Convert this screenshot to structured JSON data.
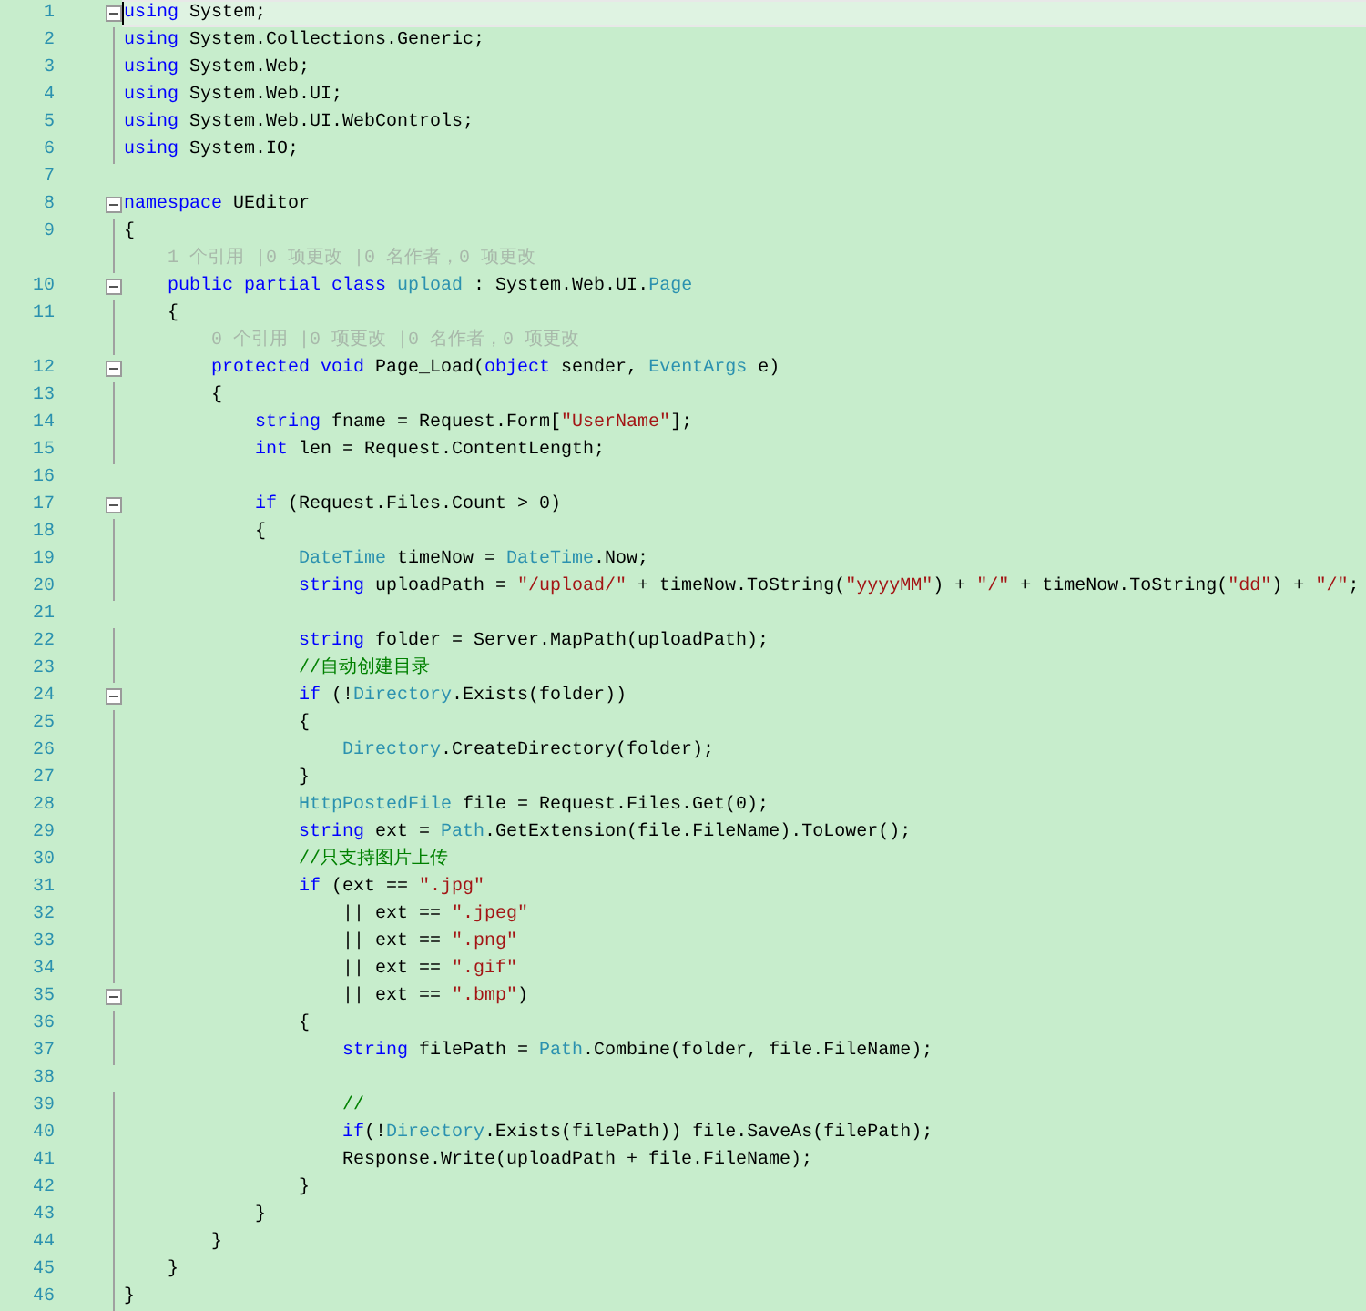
{
  "lines": [
    {
      "kind": "code",
      "n": "1",
      "fold": true,
      "current": true,
      "tokens": [
        {
          "kind": "kw",
          "text": "using"
        },
        {
          "kind": "plain",
          "text": " System;"
        }
      ]
    },
    {
      "kind": "code",
      "n": "2",
      "fold": false,
      "current": false,
      "tokens": [
        {
          "kind": "kw",
          "text": "using"
        },
        {
          "kind": "plain",
          "text": " System.Collections.Generic;"
        }
      ]
    },
    {
      "kind": "code",
      "n": "3",
      "fold": false,
      "current": false,
      "tokens": [
        {
          "kind": "kw",
          "text": "using"
        },
        {
          "kind": "plain",
          "text": " System.Web;"
        }
      ]
    },
    {
      "kind": "code",
      "n": "4",
      "fold": false,
      "current": false,
      "tokens": [
        {
          "kind": "kw",
          "text": "using"
        },
        {
          "kind": "plain",
          "text": " System.Web.UI;"
        }
      ]
    },
    {
      "kind": "code",
      "n": "5",
      "fold": false,
      "current": false,
      "tokens": [
        {
          "kind": "kw",
          "text": "using"
        },
        {
          "kind": "plain",
          "text": " System.Web.UI.WebControls;"
        }
      ]
    },
    {
      "kind": "code",
      "n": "6",
      "fold": false,
      "current": false,
      "tokens": [
        {
          "kind": "kw",
          "text": "using"
        },
        {
          "kind": "plain",
          "text": " System.IO;"
        }
      ]
    },
    {
      "kind": "code",
      "n": "7",
      "fold": false,
      "current": false
    },
    {
      "kind": "code",
      "n": "8",
      "fold": true,
      "current": false,
      "tokens": [
        {
          "kind": "kw",
          "text": "namespace"
        },
        {
          "kind": "plain",
          "text": " UEditor"
        }
      ]
    },
    {
      "kind": "code",
      "n": "9",
      "fold": false,
      "current": false,
      "tokens": [
        {
          "kind": "plain",
          "text": "{"
        }
      ],
      "children": [
        {
          "kind": "lens",
          "text": "1 个引用 |0 项更改 |0 名作者，0 项更改"
        },
        {
          "kind": "code",
          "n": "10",
          "fold": true,
          "current": false,
          "tokens": [
            {
              "kind": "kw",
              "text": "public partial class"
            },
            {
              "kind": "type",
              "text": " upload"
            },
            {
              "kind": "plain",
              "text": " : System.Web.UI."
            },
            {
              "kind": "type",
              "text": "Page"
            }
          ]
        },
        {
          "kind": "code",
          "n": "11",
          "fold": false,
          "current": false,
          "tokens": [
            {
              "kind": "plain",
              "text": "{"
            }
          ],
          "children": [
            {
              "kind": "lens",
              "text": "0 个引用 |0 项更改 |0 名作者，0 项更改"
            },
            {
              "kind": "code",
              "n": "12",
              "fold": true,
              "current": false,
              "tokens": [
                {
                  "kind": "kw",
                  "text": "protected void"
                },
                {
                  "kind": "plain",
                  "text": " Page_Load("
                },
                {
                  "kind": "kw",
                  "text": "object"
                },
                {
                  "kind": "plain",
                  "text": " sender, "
                },
                {
                  "kind": "type",
                  "text": "EventArgs"
                },
                {
                  "kind": "plain",
                  "text": " e)"
                }
              ]
            },
            {
              "kind": "code",
              "n": "13",
              "fold": false,
              "current": false,
              "tokens": [
                {
                  "kind": "plain",
                  "text": "{"
                }
              ],
              "children": [
                {
                  "kind": "code",
                  "n": "14",
                  "fold": false,
                  "current": false,
                  "tokens": [
                    {
                      "kind": "kw",
                      "text": "string"
                    },
                    {
                      "kind": "plain",
                      "text": " fname = Request.Form["
                    },
                    {
                      "kind": "str",
                      "text": "\"UserName\""
                    },
                    {
                      "kind": "plain",
                      "text": "];"
                    }
                  ]
                },
                {
                  "kind": "code",
                  "n": "15",
                  "fold": false,
                  "current": false,
                  "tokens": [
                    {
                      "kind": "kw",
                      "text": "int"
                    },
                    {
                      "kind": "plain",
                      "text": " len = Request.ContentLength;"
                    }
                  ]
                },
                {
                  "kind": "code",
                  "n": "16",
                  "fold": false,
                  "current": false
                },
                {
                  "kind": "code",
                  "n": "17",
                  "fold": true,
                  "current": false,
                  "tokens": [
                    {
                      "kind": "kw",
                      "text": "if"
                    },
                    {
                      "kind": "plain",
                      "text": " (Request.Files.Count > 0)"
                    }
                  ]
                },
                {
                  "kind": "code",
                  "n": "18",
                  "fold": false,
                  "current": false,
                  "tokens": [
                    {
                      "kind": "plain",
                      "text": "{"
                    }
                  ],
                  "children": [
                    {
                      "kind": "code",
                      "n": "19",
                      "fold": false,
                      "current": false,
                      "tokens": [
                        {
                          "kind": "type",
                          "text": "DateTime"
                        },
                        {
                          "kind": "plain",
                          "text": " timeNow = "
                        },
                        {
                          "kind": "type",
                          "text": "DateTime"
                        },
                        {
                          "kind": "plain",
                          "text": ".Now;"
                        }
                      ]
                    },
                    {
                      "kind": "code",
                      "n": "20",
                      "fold": false,
                      "current": false,
                      "tokens": [
                        {
                          "kind": "kw",
                          "text": "string"
                        },
                        {
                          "kind": "plain",
                          "text": " uploadPath = "
                        },
                        {
                          "kind": "str",
                          "text": "\"/upload/\""
                        },
                        {
                          "kind": "plain",
                          "text": " + timeNow.ToString("
                        },
                        {
                          "kind": "str",
                          "text": "\"yyyyMM\""
                        },
                        {
                          "kind": "plain",
                          "text": ") + "
                        },
                        {
                          "kind": "str",
                          "text": "\"/\""
                        },
                        {
                          "kind": "plain",
                          "text": " + timeNow.ToString("
                        },
                        {
                          "kind": "str",
                          "text": "\"dd\""
                        },
                        {
                          "kind": "plain",
                          "text": ") + "
                        },
                        {
                          "kind": "str",
                          "text": "\"/\""
                        },
                        {
                          "kind": "plain",
                          "text": ";"
                        }
                      ]
                    },
                    {
                      "kind": "code",
                      "n": "21",
                      "fold": false,
                      "current": false
                    },
                    {
                      "kind": "code",
                      "n": "22",
                      "fold": false,
                      "current": false,
                      "tokens": [
                        {
                          "kind": "kw",
                          "text": "string"
                        },
                        {
                          "kind": "plain",
                          "text": " folder = Server.MapPath(uploadPath);"
                        }
                      ]
                    },
                    {
                      "kind": "code",
                      "n": "23",
                      "fold": false,
                      "current": false,
                      "tokens": [
                        {
                          "kind": "comment",
                          "text": "//自动创建目录"
                        }
                      ]
                    },
                    {
                      "kind": "code",
                      "n": "24",
                      "fold": true,
                      "current": false,
                      "tokens": [
                        {
                          "kind": "kw",
                          "text": "if"
                        },
                        {
                          "kind": "plain",
                          "text": " (!"
                        },
                        {
                          "kind": "type",
                          "text": "Directory"
                        },
                        {
                          "kind": "plain",
                          "text": ".Exists(folder))"
                        }
                      ]
                    },
                    {
                      "kind": "code",
                      "n": "25",
                      "fold": false,
                      "current": false,
                      "tokens": [
                        {
                          "kind": "plain",
                          "text": "{"
                        }
                      ],
                      "children": [
                        {
                          "kind": "code",
                          "n": "26",
                          "fold": false,
                          "current": false,
                          "tokens": [
                            {
                              "kind": "type",
                              "text": "Directory"
                            },
                            {
                              "kind": "plain",
                              "text": ".CreateDirectory(folder);"
                            }
                          ]
                        }
                      ]
                    },
                    {
                      "kind": "code",
                      "n": "27",
                      "fold": false,
                      "current": false,
                      "tokens": [
                        {
                          "kind": "plain",
                          "text": "}"
                        }
                      ]
                    },
                    {
                      "kind": "code",
                      "n": "28",
                      "fold": false,
                      "current": false,
                      "tokens": [
                        {
                          "kind": "type",
                          "text": "HttpPostedFile"
                        },
                        {
                          "kind": "plain",
                          "text": " file = Request.Files.Get(0);"
                        }
                      ]
                    },
                    {
                      "kind": "code",
                      "n": "29",
                      "fold": false,
                      "current": false,
                      "tokens": [
                        {
                          "kind": "kw",
                          "text": "string"
                        },
                        {
                          "kind": "plain",
                          "text": " ext = "
                        },
                        {
                          "kind": "type",
                          "text": "Path"
                        },
                        {
                          "kind": "plain",
                          "text": ".GetExtension(file.FileName).ToLower();"
                        }
                      ]
                    },
                    {
                      "kind": "code",
                      "n": "30",
                      "fold": false,
                      "current": false,
                      "tokens": [
                        {
                          "kind": "comment",
                          "text": "//只支持图片上传"
                        }
                      ]
                    },
                    {
                      "kind": "code",
                      "n": "31",
                      "fold": false,
                      "current": false,
                      "tokens": [
                        {
                          "kind": "kw",
                          "text": "if"
                        },
                        {
                          "kind": "plain",
                          "text": " (ext == "
                        },
                        {
                          "kind": "str",
                          "text": "\".jpg\""
                        }
                      ],
                      "children": [
                        {
                          "kind": "code",
                          "n": "32",
                          "fold": false,
                          "current": false,
                          "tokens": [
                            {
                              "kind": "plain",
                              "text": "|| ext == "
                            },
                            {
                              "kind": "str",
                              "text": "\".jpeg\""
                            }
                          ]
                        },
                        {
                          "kind": "code",
                          "n": "33",
                          "fold": false,
                          "current": false,
                          "tokens": [
                            {
                              "kind": "plain",
                              "text": "|| ext == "
                            },
                            {
                              "kind": "str",
                              "text": "\".png\""
                            }
                          ]
                        },
                        {
                          "kind": "code",
                          "n": "34",
                          "fold": false,
                          "current": false,
                          "tokens": [
                            {
                              "kind": "plain",
                              "text": "|| ext == "
                            },
                            {
                              "kind": "str",
                              "text": "\".gif\""
                            }
                          ]
                        },
                        {
                          "kind": "code",
                          "n": "35",
                          "fold": true,
                          "current": false,
                          "tokens": [
                            {
                              "kind": "plain",
                              "text": "|| ext == "
                            },
                            {
                              "kind": "str",
                              "text": "\".bmp\""
                            },
                            {
                              "kind": "plain",
                              "text": ")"
                            }
                          ]
                        }
                      ]
                    },
                    {
                      "kind": "code",
                      "n": "36",
                      "fold": false,
                      "current": false,
                      "tokens": [
                        {
                          "kind": "plain",
                          "text": "{"
                        }
                      ],
                      "children": [
                        {
                          "kind": "code",
                          "n": "37",
                          "fold": false,
                          "current": false,
                          "tokens": [
                            {
                              "kind": "kw",
                              "text": "string"
                            },
                            {
                              "kind": "plain",
                              "text": " filePath = "
                            },
                            {
                              "kind": "type",
                              "text": "Path"
                            },
                            {
                              "kind": "plain",
                              "text": ".Combine(folder, file.FileName);"
                            }
                          ]
                        },
                        {
                          "kind": "code",
                          "n": "38",
                          "fold": false,
                          "current": false
                        },
                        {
                          "kind": "code",
                          "n": "39",
                          "fold": false,
                          "current": false,
                          "tokens": [
                            {
                              "kind": "comment",
                              "text": "//"
                            }
                          ]
                        },
                        {
                          "kind": "code",
                          "n": "40",
                          "fold": false,
                          "current": false,
                          "tokens": [
                            {
                              "kind": "kw",
                              "text": "if"
                            },
                            {
                              "kind": "plain",
                              "text": "(!"
                            },
                            {
                              "kind": "type",
                              "text": "Directory"
                            },
                            {
                              "kind": "plain",
                              "text": ".Exists(filePath)) file.SaveAs(filePath);"
                            }
                          ]
                        },
                        {
                          "kind": "code",
                          "n": "41",
                          "fold": false,
                          "current": false,
                          "tokens": [
                            {
                              "kind": "plain",
                              "text": "Response.Write(uploadPath + file.FileName);"
                            }
                          ]
                        }
                      ]
                    },
                    {
                      "kind": "code",
                      "n": "42",
                      "fold": false,
                      "current": false,
                      "tokens": [
                        {
                          "kind": "plain",
                          "text": "}"
                        }
                      ]
                    }
                  ]
                },
                {
                  "kind": "code",
                  "n": "43",
                  "fold": false,
                  "current": false,
                  "tokens": [
                    {
                      "kind": "plain",
                      "text": "}"
                    }
                  ]
                }
              ]
            },
            {
              "kind": "code",
              "n": "44",
              "fold": false,
              "current": false,
              "tokens": [
                {
                  "kind": "plain",
                  "text": "}"
                }
              ]
            }
          ]
        },
        {
          "kind": "code",
          "n": "45",
          "fold": false,
          "current": false,
          "tokens": [
            {
              "kind": "plain",
              "text": "}"
            }
          ]
        }
      ]
    },
    {
      "kind": "code",
      "n": "46",
      "fold": false,
      "current": false,
      "tokens": [
        {
          "kind": "plain",
          "text": "}"
        }
      ]
    }
  ]
}
